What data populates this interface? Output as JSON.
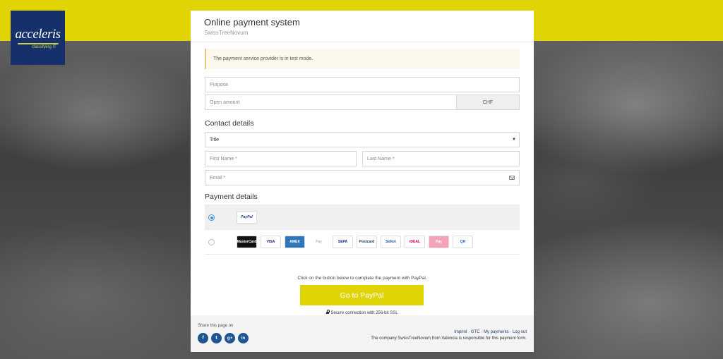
{
  "brand": {
    "logo_name": "acceleris",
    "logo_tagline": "classifying IT"
  },
  "header": {
    "title": "Online payment system",
    "subtitle": "SwissTreeNovum"
  },
  "alert": {
    "text": "The payment service provider is in test mode."
  },
  "form": {
    "purpose_placeholder": "Purpose",
    "amount_placeholder": "Open amount",
    "currency": "CHF"
  },
  "contact": {
    "title": "Contact details",
    "salutation_selected": "Title",
    "first_name_placeholder": "First Name *",
    "last_name_placeholder": "Last Name *",
    "email_placeholder": "Email *"
  },
  "payment": {
    "title": "Payment details",
    "paypal_label": "PayPal",
    "methods": [
      "MasterCard",
      "VISA",
      "AMEX",
      "Pay",
      "SEPA",
      "Postcard",
      "Sofort",
      "iDEAL",
      "Pay",
      "QR"
    ],
    "info_text": "Click on the button below to complete the payment with PayPal.",
    "cta_label": "Go to PayPal",
    "secure_text": "Secure connection with 256-bit SSL"
  },
  "footer": {
    "share_label": "Share this page on",
    "social": [
      "f",
      "t",
      "g+",
      "in"
    ],
    "links": [
      "Imprint",
      "GTC",
      "My payments",
      "Log out"
    ],
    "note": "The company SwissTreeNovum from Valencia is responsible for this payment form."
  },
  "colors": {
    "accent": "#e0d404",
    "brand_navy": "#15306a",
    "radio": "#3b8fd8"
  }
}
